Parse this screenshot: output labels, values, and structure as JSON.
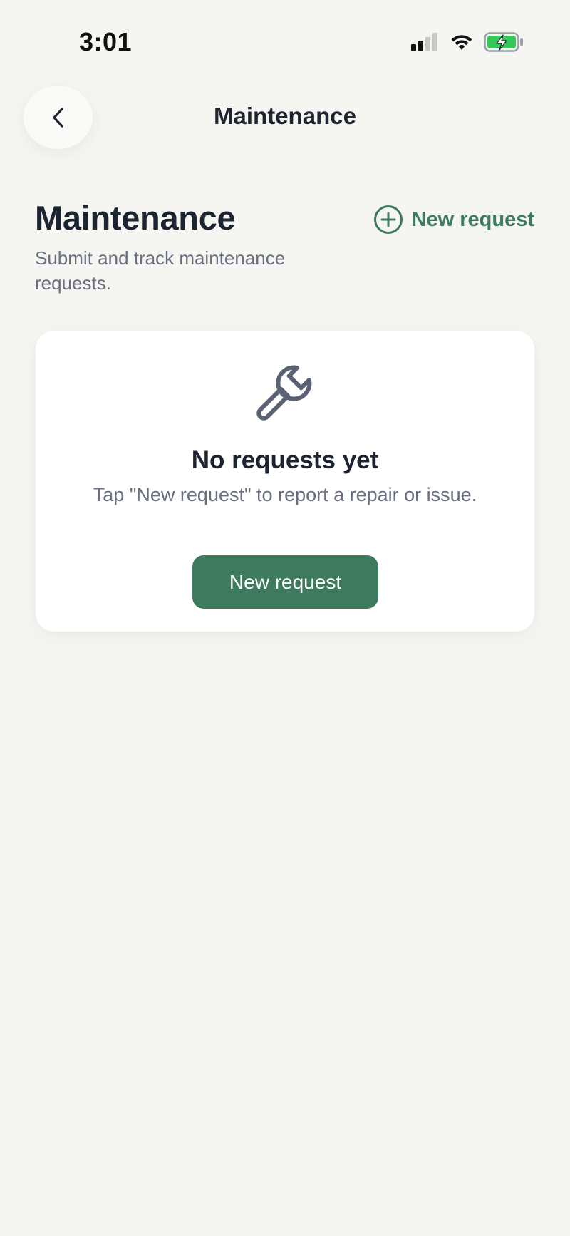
{
  "status_bar": {
    "time": "3:01",
    "icons": [
      "cellular-signal-icon",
      "wifi-icon",
      "battery-charging-icon"
    ]
  },
  "nav": {
    "back_icon": "chevron-left-icon",
    "title": "Maintenance"
  },
  "header": {
    "title": "Maintenance",
    "subtitle": "Submit and track maintenance requests.",
    "action_label": "New request",
    "action_icon": "plus-circle-icon"
  },
  "empty_state": {
    "icon": "wrench-icon",
    "title": "No requests yet",
    "message": "Tap \"New request\" to report a repair or issue.",
    "button_label": "New request"
  },
  "colors": {
    "background": "#f5f5f2",
    "accent": "#3d7a5e",
    "card": "#ffffff",
    "text_primary": "#1c2331",
    "text_secondary": "#6b7080",
    "battery_fill": "#34c759"
  }
}
